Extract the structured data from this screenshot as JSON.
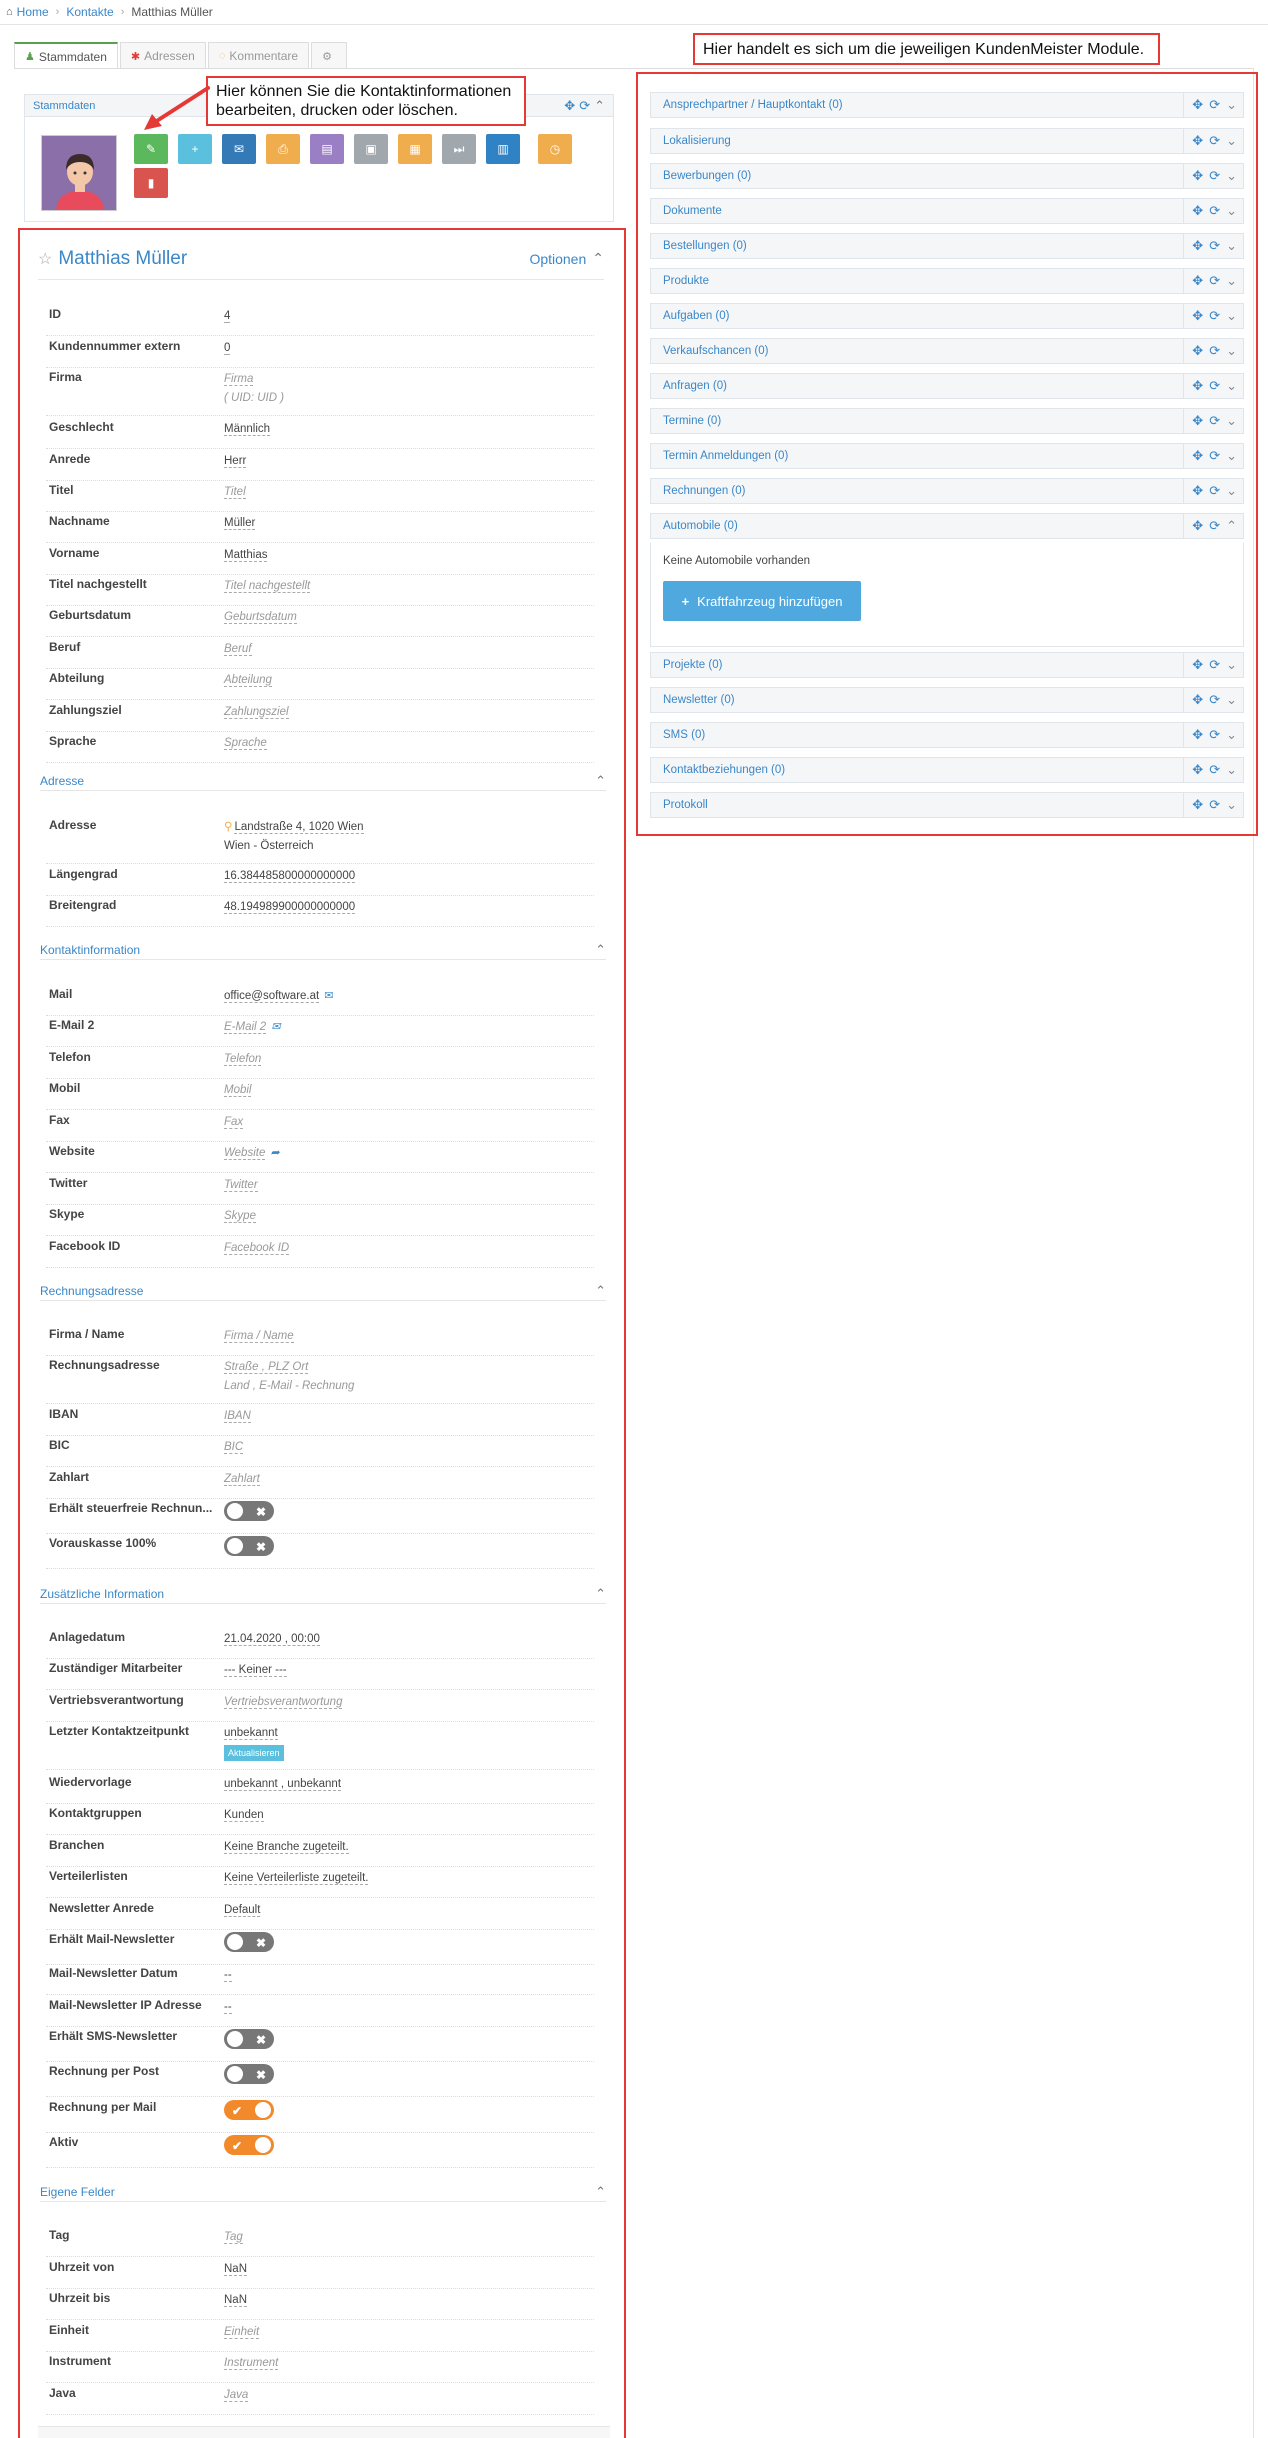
{
  "breadcrumb": {
    "home": "Home",
    "contacts": "Kontakte",
    "current": "Matthias Müller"
  },
  "tabs": [
    {
      "label": "Stammdaten",
      "icon": "user-icon"
    },
    {
      "label": "Adressen",
      "icon": "asterisk-icon"
    },
    {
      "label": "Kommentare",
      "icon": "comment-icon"
    },
    {
      "label": "",
      "icon": "gear-icon"
    }
  ],
  "stammdaten_panel": {
    "title": "Stammdaten"
  },
  "action_buttons": [
    {
      "name": "edit-button",
      "icon": "pencil-icon",
      "glyph": "✎",
      "color": "#5cb85c"
    },
    {
      "name": "add-button",
      "icon": "plus-icon",
      "glyph": "+",
      "color": "#5bc0de"
    },
    {
      "name": "email-button",
      "icon": "envelope-icon",
      "glyph": "✉",
      "color": "#337ab7"
    },
    {
      "name": "print-button",
      "icon": "print-icon",
      "glyph": "⎙",
      "color": "#f0ad4e"
    },
    {
      "name": "document-button",
      "icon": "file-icon",
      "glyph": "▤",
      "color": "#9b7fc4"
    },
    {
      "name": "image-button",
      "icon": "picture-icon",
      "glyph": "▣",
      "color": "#a0a8ae"
    },
    {
      "name": "save-button",
      "icon": "floppy-icon",
      "glyph": "▦",
      "color": "#f0ad4e"
    },
    {
      "name": "forward-button",
      "icon": "fast-forward-icon",
      "glyph": "⏭",
      "color": "#a0a8ae"
    },
    {
      "name": "pdf-button",
      "icon": "file-text-icon",
      "glyph": "▥",
      "color": "#2f82c4"
    },
    {
      "name": "timer-button",
      "icon": "stopwatch-icon",
      "glyph": "◷",
      "color": "#f0ad4e"
    },
    {
      "name": "delete-button",
      "icon": "trash-icon",
      "glyph": "▮",
      "color": "#d9534f"
    }
  ],
  "callouts": {
    "left": "Hier können Sie die Kontaktinformationen bearbeiten, drucken oder löschen.",
    "right": "Hier handelt es sich um die jeweiligen KundenMeister Module."
  },
  "contact": {
    "name": "Matthias Müller",
    "options": "Optionen"
  },
  "sections": {
    "adresse": "Adresse",
    "kontakt": "Kontaktinformation",
    "rechnung": "Rechnungsadresse",
    "zusatz": "Zusätzliche Information",
    "eigene": "Eigene Felder"
  },
  "fields": {
    "id": {
      "label": "ID",
      "value": "4"
    },
    "kundennummer": {
      "label": "Kundennummer extern",
      "value": "0"
    },
    "firma": {
      "label": "Firma",
      "value": "Firma",
      "line2": "( UID: UID )"
    },
    "geschlecht": {
      "label": "Geschlecht",
      "value": "Männlich"
    },
    "anrede": {
      "label": "Anrede",
      "value": "Herr"
    },
    "titel": {
      "label": "Titel",
      "value": "Titel"
    },
    "nachname": {
      "label": "Nachname",
      "value": "Müller"
    },
    "vorname": {
      "label": "Vorname",
      "value": "Matthias"
    },
    "titel_nach": {
      "label": "Titel nachgestellt",
      "value": "Titel nachgestellt"
    },
    "geburtsdatum": {
      "label": "Geburtsdatum",
      "value": "Geburtsdatum"
    },
    "beruf": {
      "label": "Beruf",
      "value": "Beruf"
    },
    "abteilung": {
      "label": "Abteilung",
      "value": "Abteilung"
    },
    "zahlungsziel": {
      "label": "Zahlungsziel",
      "value": "Zahlungsziel"
    },
    "sprache": {
      "label": "Sprache",
      "value": "Sprache"
    },
    "adresse": {
      "label": "Adresse",
      "value": "Landstraße 4, 1020 Wien",
      "line2": "Wien  - Österreich"
    },
    "laengengrad": {
      "label": "Längengrad",
      "value": "16.384485800000000000"
    },
    "breitengrad": {
      "label": "Breitengrad",
      "value": "48.194989900000000000"
    },
    "mail": {
      "label": "Mail",
      "value": "office@software.at"
    },
    "email2": {
      "label": "E-Mail 2",
      "value": "E-Mail 2"
    },
    "telefon": {
      "label": "Telefon",
      "value": "Telefon"
    },
    "mobil": {
      "label": "Mobil",
      "value": "Mobil"
    },
    "fax": {
      "label": "Fax",
      "value": "Fax"
    },
    "website": {
      "label": "Website",
      "value": "Website"
    },
    "twitter": {
      "label": "Twitter",
      "value": "Twitter"
    },
    "skype": {
      "label": "Skype",
      "value": "Skype"
    },
    "facebook": {
      "label": "Facebook ID",
      "value": "Facebook ID"
    },
    "firma_name": {
      "label": "Firma / Name",
      "value": "Firma / Name"
    },
    "rechnungsadresse": {
      "label": "Rechnungsadresse",
      "value": "Straße ,  PLZ   Ort",
      "line2": "Land , E-Mail - Rechnung"
    },
    "iban": {
      "label": "IBAN",
      "value": "IBAN"
    },
    "bic": {
      "label": "BIC",
      "value": "BIC"
    },
    "zahlart": {
      "label": "Zahlart",
      "value": "Zahlart"
    },
    "steuerfrei": {
      "label": "Erhält steuerfreie Rechnun...",
      "toggle": false
    },
    "vorauskasse": {
      "label": "Vorauskasse 100%",
      "toggle": false
    },
    "anlagedatum": {
      "label": "Anlagedatum",
      "value": "21.04.2020 ,  00:00"
    },
    "mitarbeiter": {
      "label": "Zuständiger Mitarbeiter",
      "value": "--- Keiner ---"
    },
    "vertrieb": {
      "label": "Vertriebsverantwortung",
      "value": "Vertriebsverantwortung"
    },
    "letzter_kontakt": {
      "label": "Letzter Kontaktzeitpunkt",
      "value": "unbekannt",
      "badge": "Aktualisieren"
    },
    "wiedervorlage": {
      "label": "Wiedervorlage",
      "value": "unbekannt , unbekannt"
    },
    "kontaktgruppen": {
      "label": "Kontaktgruppen",
      "value": "Kunden"
    },
    "branchen": {
      "label": "Branchen",
      "value": "Keine Branche zugeteilt."
    },
    "verteilerlisten": {
      "label": "Verteilerlisten",
      "value": "Keine Verteilerliste zugeteilt."
    },
    "newsletter_anrede": {
      "label": "Newsletter Anrede",
      "value": "Default"
    },
    "mail_newsletter": {
      "label": "Erhält Mail-Newsletter",
      "toggle": false
    },
    "newsletter_datum": {
      "label": "Mail-Newsletter Datum",
      "value": "--"
    },
    "newsletter_ip": {
      "label": "Mail-Newsletter IP Adresse",
      "value": "--"
    },
    "sms_newsletter": {
      "label": "Erhält SMS-Newsletter",
      "toggle": false
    },
    "rechnung_post": {
      "label": "Rechnung per Post",
      "toggle": false
    },
    "rechnung_mail": {
      "label": "Rechnung per Mail",
      "toggle": true
    },
    "aktiv": {
      "label": "Aktiv",
      "toggle": true
    },
    "tag": {
      "label": "Tag",
      "value": "Tag"
    },
    "uhrzeit_von": {
      "label": "Uhrzeit von",
      "value": "NaN"
    },
    "uhrzeit_bis": {
      "label": "Uhrzeit bis",
      "value": "NaN"
    },
    "einheit": {
      "label": "Einheit",
      "value": "Einheit"
    },
    "instrument": {
      "label": "Instrument",
      "value": "Instrument"
    },
    "java": {
      "label": "Java",
      "value": "Java"
    }
  },
  "modules": [
    "Ansprechpartner / Hauptkontakt (0)",
    "Lokalisierung",
    "Bewerbungen (0)",
    "Dokumente",
    "Bestellungen (0)",
    "Produkte",
    "Aufgaben (0)",
    "Verkaufschancen (0)",
    "Anfragen (0)",
    "Termine (0)",
    "Termin Anmeldungen (0)",
    "Rechnungen (0)",
    "Automobile (0)",
    "Projekte (0)",
    "Newsletter (0)",
    "SMS (0)",
    "Kontaktbeziehungen (0)",
    "Protokoll"
  ],
  "automobile": {
    "empty": "Keine Automobile vorhanden",
    "add_button": "Kraftfahrzeug hinzufügen"
  }
}
